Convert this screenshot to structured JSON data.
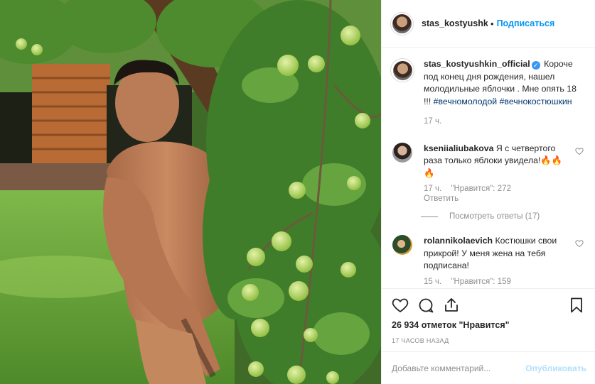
{
  "post": {
    "username": "stas_kostyushkin_of",
    "dot": "•",
    "follow_label": "Подписаться"
  },
  "caption": {
    "username": "stas_kostyushkin_official",
    "verified_mark": "✓",
    "text": "Короче под конец дня рождения, нашел молодильные яблочки . Мне опять 18 !!!",
    "hashtag_1": "#вечномолодой",
    "hashtag_2": "#вечнокостюшкин",
    "time": "17 ч."
  },
  "comments": [
    {
      "username": "kseniialiubakova",
      "text": "Я с четвертого раза только яблоки увидела!🔥🔥🔥",
      "time": "17 ч.",
      "likes": "\"Нравится\": 272",
      "reply": "Ответить",
      "view_replies": "Посмотреть ответы (17)"
    },
    {
      "username": "rolannikolaevich",
      "text": "Костюшки свои прикрой! У меня жена на тебя подписана!",
      "time": "15 ч.",
      "likes": "\"Нравится\": 159"
    }
  ],
  "actions": {
    "likes_count": "26 934 отметок \"Нравится\"",
    "posted_ago": "17 ЧАСОВ НАЗАД",
    "comment_placeholder": "Добавьте комментарий...",
    "publish_label": "Опубликовать"
  },
  "colors": {
    "accent": "#0095f6",
    "verified": "#3897f0",
    "hashtag": "#00376b",
    "secondary_text": "#8e8e8e",
    "publish_disabled": "#b2dffc"
  },
  "icons": [
    "heart-icon",
    "comment-icon",
    "share-icon",
    "bookmark-icon",
    "verified-badge-icon"
  ]
}
